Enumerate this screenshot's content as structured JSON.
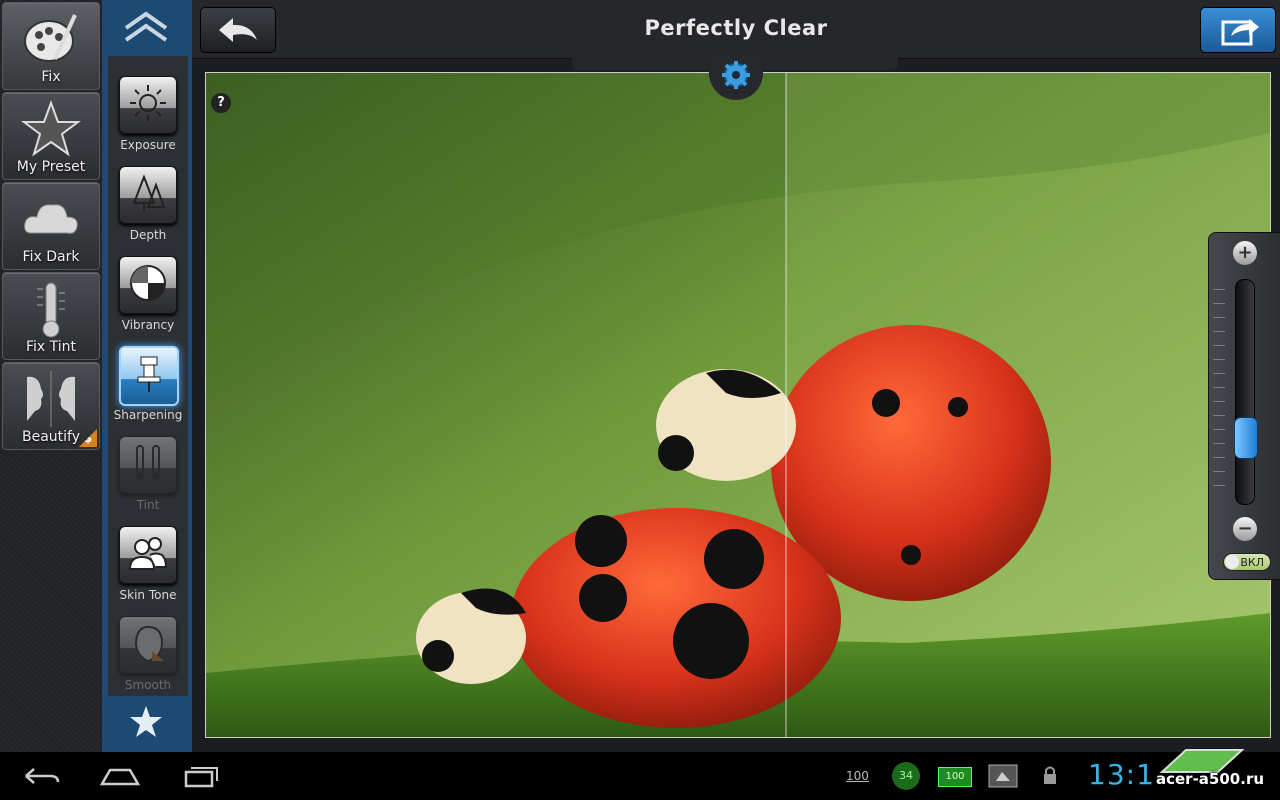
{
  "app": {
    "title": "Perfectly Clear"
  },
  "presets": [
    {
      "label": "Fix",
      "icon": "palette-icon",
      "active": true
    },
    {
      "label": "My Preset",
      "icon": "star-icon"
    },
    {
      "label": "Fix Dark",
      "icon": "cloud-icon"
    },
    {
      "label": "Fix Tint",
      "icon": "thermometer-icon"
    },
    {
      "label": "Beautify",
      "icon": "faces-icon",
      "badge": "$"
    }
  ],
  "tools": [
    {
      "label": "Exposure",
      "icon": "sun-icon",
      "state": "normal"
    },
    {
      "label": "Depth",
      "icon": "trees-icon",
      "state": "normal"
    },
    {
      "label": "Vibrancy",
      "icon": "color-wheel-icon",
      "state": "normal"
    },
    {
      "label": "Sharpening",
      "icon": "pin-icon",
      "state": "selected"
    },
    {
      "label": "Tint",
      "icon": "thermometers-icon",
      "state": "disabled"
    },
    {
      "label": "Skin Tone",
      "icon": "people-icon",
      "state": "normal"
    },
    {
      "label": "Smooth",
      "icon": "face-smooth-icon",
      "state": "disabled"
    }
  ],
  "photo": {
    "help": "?",
    "subject": "ladybugs-photo"
  },
  "slider": {
    "plus": "+",
    "minus": "−",
    "value_fraction": 0.25,
    "toggle_label": "ВКЛ"
  },
  "status_bar": {
    "wifi_level": "100",
    "notification": "34",
    "battery": "100",
    "clock": "13:1"
  },
  "watermark": {
    "text": "acer-a500.ru"
  },
  "colors": {
    "accent": "#33b5e5",
    "tool_column": "#1d4a72",
    "selected_tool": "#2a7ec2"
  }
}
